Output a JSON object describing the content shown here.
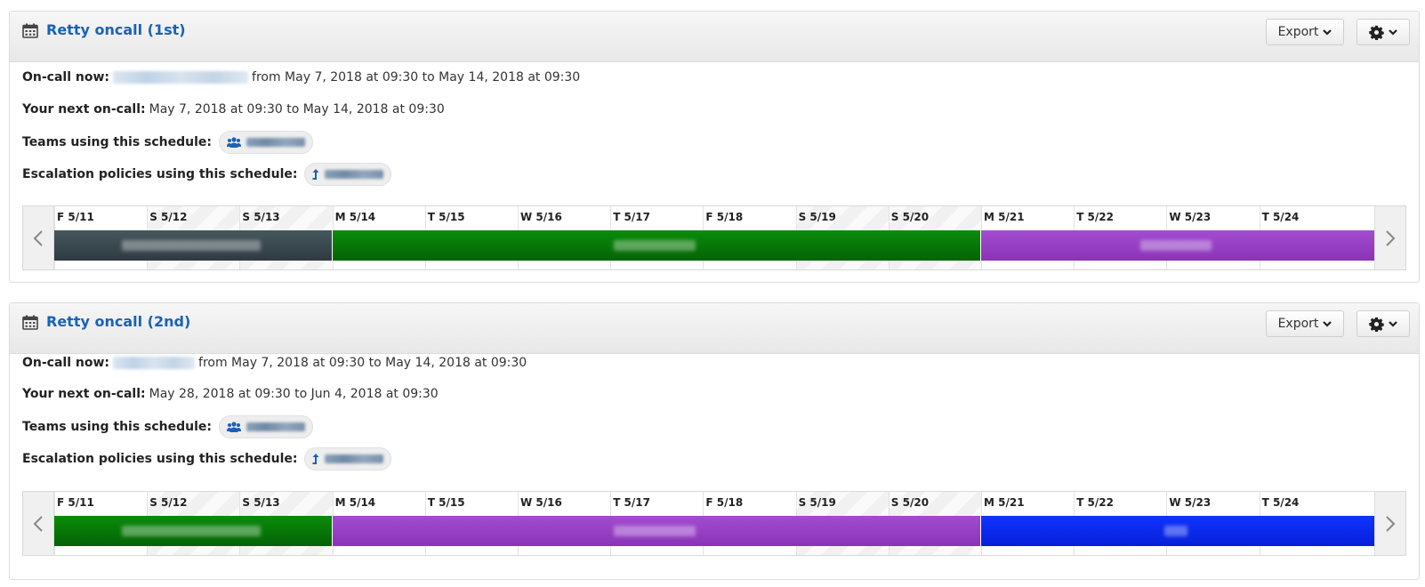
{
  "schedules": [
    {
      "title": "Retty oncall (1st)",
      "export_label": "Export",
      "on_call_now_label": "On-call now:",
      "on_call_now_range": "from May 7, 2018 at 09:30 to May 14, 2018 at 09:30",
      "next_on_call_label": "Your next on-call:",
      "next_on_call_range": "May 7, 2018 at 09:30 to May 14, 2018 at 09:30",
      "teams_label": "Teams using this schedule:",
      "escalation_label": "Escalation policies using this schedule:",
      "days": [
        "F 5/11",
        "S 5/12",
        "S 5/13",
        "M 5/14",
        "T 5/15",
        "W 5/16",
        "T 5/17",
        "F 5/18",
        "S 5/19",
        "S 5/20",
        "M 5/21",
        "T 5/22",
        "W 5/23",
        "T 5/24"
      ],
      "bars": [
        {
          "color": "slate",
          "from_day": "F 5/11",
          "to_day": "M 5/14"
        },
        {
          "color": "green",
          "from_day": "M 5/14",
          "to_day": "M 5/21"
        },
        {
          "color": "purple",
          "from_day": "M 5/21",
          "to_day": "T 5/24"
        }
      ]
    },
    {
      "title": "Retty oncall (2nd)",
      "export_label": "Export",
      "on_call_now_label": "On-call now:",
      "on_call_now_range": "from May 7, 2018 at 09:30 to May 14, 2018 at 09:30",
      "next_on_call_label": "Your next on-call:",
      "next_on_call_range": "May 28, 2018 at 09:30 to Jun 4, 2018 at 09:30",
      "teams_label": "Teams using this schedule:",
      "escalation_label": "Escalation policies using this schedule:",
      "days": [
        "F 5/11",
        "S 5/12",
        "S 5/13",
        "M 5/14",
        "T 5/15",
        "W 5/16",
        "T 5/17",
        "F 5/18",
        "S 5/19",
        "S 5/20",
        "M 5/21",
        "T 5/22",
        "W 5/23",
        "T 5/24"
      ],
      "bars": [
        {
          "color": "green",
          "from_day": "F 5/11",
          "to_day": "M 5/14"
        },
        {
          "color": "purple",
          "from_day": "M 5/14",
          "to_day": "M 5/21"
        },
        {
          "color": "blue",
          "from_day": "M 5/21",
          "to_day": "T 5/24"
        }
      ]
    }
  ],
  "icons": {
    "calendar": "calendar-icon",
    "gear": "gear-icon",
    "chevron": "chevron-down-icon",
    "team": "team-icon",
    "escalation": "escalation-icon",
    "prev": "chevron-left-icon",
    "next": "chevron-right-icon"
  },
  "colors": {
    "title": "#1a62b5",
    "slate": "#3a4a51",
    "green": "#088008",
    "purple": "#9640c4",
    "blue": "#0a2aee"
  }
}
